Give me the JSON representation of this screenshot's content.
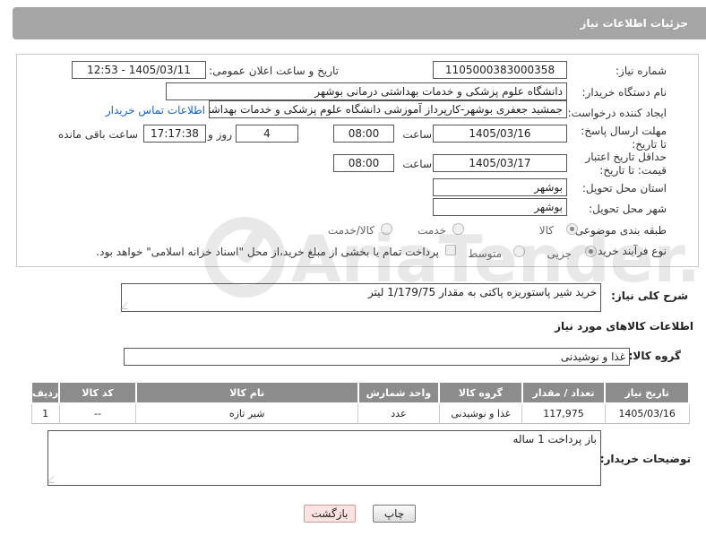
{
  "header": {
    "title": "جزئیات اطلاعات نیاز"
  },
  "form": {
    "need_number_label": "شماره نیاز:",
    "need_number": "1105000383000358",
    "announce_label": "تاریخ و ساعت اعلان عمومی:",
    "announce_value": "1405/03/11 - 12:53",
    "buyer_org_label": "نام دستگاه خریدار:",
    "buyer_org": "دانشگاه علوم پزشکی و خدمات بهداشتی درمانی بوشهر",
    "creator_label": "ایجاد کننده درخواست:",
    "creator": "جمشید جعفری بوشهر-کارپرداز آموزشی دانشگاه علوم پزشکی و خدمات بهداشتی",
    "contact_link": "اطلاعات تماس خریدار",
    "deadline_label": "مهلت ارسال پاسخ: تا تاریخ:",
    "deadline_date": "1405/03/16",
    "time_label": "ساعت",
    "deadline_time": "08:00",
    "days_value": "4",
    "days_label": "روز و",
    "remaining_time": "17:17:38",
    "remaining_label": "ساعت باقی مانده",
    "price_validity_label": "حداقل تاریخ اعتبار قیمت: تا تاریخ:",
    "price_date": "1405/03/17",
    "price_time": "08:00",
    "province_label": "استان محل تحویل:",
    "province": "بوشهر",
    "city_label": "شهر محل تحویل:",
    "city": "بوشهر",
    "category_label": "طبقه بندی موضوعی:",
    "category_options": [
      "کالا",
      "خدمت",
      "کالا/خدمت"
    ],
    "purchase_type_label": "نوع فرآیند خرید :",
    "purchase_options": [
      "جزیی",
      "متوسط"
    ],
    "payment_note": "پرداخت تمام یا بخشی از مبلغ خرید،از محل \"اسناد خزانه اسلامی\" خواهد بود."
  },
  "description": {
    "label": "شرح کلی نیاز:",
    "text": "خرید شیر پاستوریزه پاکتی به مقدار 1/179/75 لیتر"
  },
  "goods": {
    "section_title": "اطلاعات کالاهای مورد نیاز",
    "group_label": "گروه کالا:",
    "group_value": "غذا و نوشیدنی",
    "columns": [
      "ردیف",
      "کد کالا",
      "نام کالا",
      "واحد شمارش",
      "گروه کالا",
      "تعداد / مقدار",
      "تاریخ نیاز"
    ],
    "rows": [
      [
        "1",
        "--",
        "شیر تازه",
        "عدد",
        "غذا و نوشیدنی",
        "117,975",
        "1405/03/16"
      ]
    ]
  },
  "buyer_notes": {
    "label": "توضیحات خریدار:",
    "text": "باز پرداخت 1 ساله"
  },
  "buttons": {
    "print": "چاپ",
    "back": "بازگشت"
  },
  "watermark": {
    "text": "AriaTender.neT"
  }
}
